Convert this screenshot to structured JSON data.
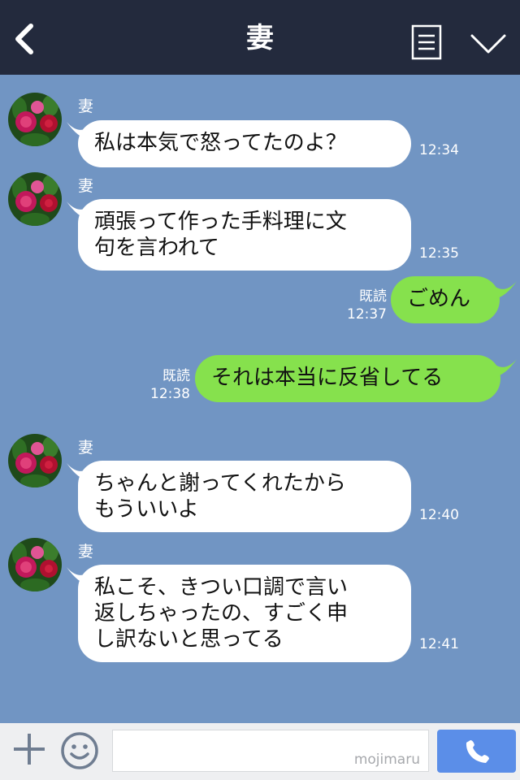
{
  "header": {
    "title": "妻"
  },
  "messages": [
    {
      "side": "in",
      "sender": "妻",
      "lines": [
        "私は本気で怒ってたのよ？"
      ],
      "time": "12:34"
    },
    {
      "side": "in",
      "sender": "妻",
      "lines": [
        "頑張って作った手料理に文",
        "句を言われて"
      ],
      "time": "12:35"
    },
    {
      "side": "out",
      "read": "既読",
      "lines": [
        "ごめん"
      ],
      "time": "12:37"
    },
    {
      "side": "out",
      "read": "既読",
      "lines": [
        "それは本当に反省してる"
      ],
      "time": "12:38"
    },
    {
      "side": "in",
      "sender": "妻",
      "lines": [
        "ちゃんと謝ってくれたから",
        "もういいよ"
      ],
      "time": "12:40"
    },
    {
      "side": "in",
      "sender": "妻",
      "lines": [
        "私こそ、きつい口調で言い",
        "返しちゃったの、すごく申",
        "し訳ないと思ってる"
      ],
      "time": "12:41"
    }
  ],
  "footer": {
    "watermark": "mojimaru",
    "input_value": ""
  },
  "colors": {
    "header": "#232a3d",
    "background": "#7195c3",
    "incoming": "#ffffff",
    "outgoing": "#86e14d",
    "call": "#5b8ee8"
  }
}
